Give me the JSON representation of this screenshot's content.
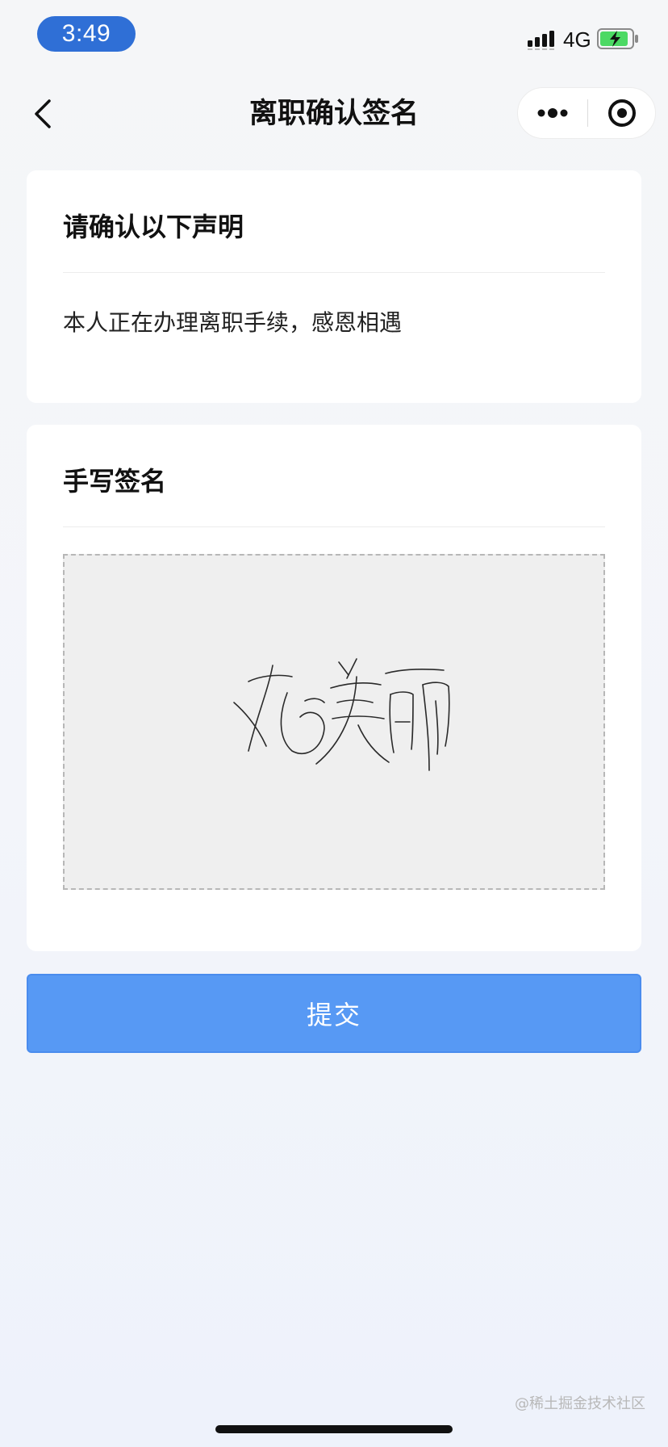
{
  "status_bar": {
    "time": "3:49",
    "network": "4G",
    "signal_icon": "cellular-signal-icon",
    "battery_icon": "battery-charging-icon",
    "time_pill_color": "#2f6fd6",
    "battery_color": "#4cd964"
  },
  "nav": {
    "title": "离职确认签名",
    "back_icon": "chevron-left-icon",
    "more_icon": "more-dots-icon",
    "close_icon": "target-close-icon"
  },
  "statement": {
    "heading": "请确认以下声明",
    "text": "本人正在办理离职手续，感恩相遇"
  },
  "signature": {
    "heading": "手写签名"
  },
  "submit": {
    "label": "提交",
    "color": "#5799f4"
  },
  "watermark": "@稀土掘金技术社区"
}
